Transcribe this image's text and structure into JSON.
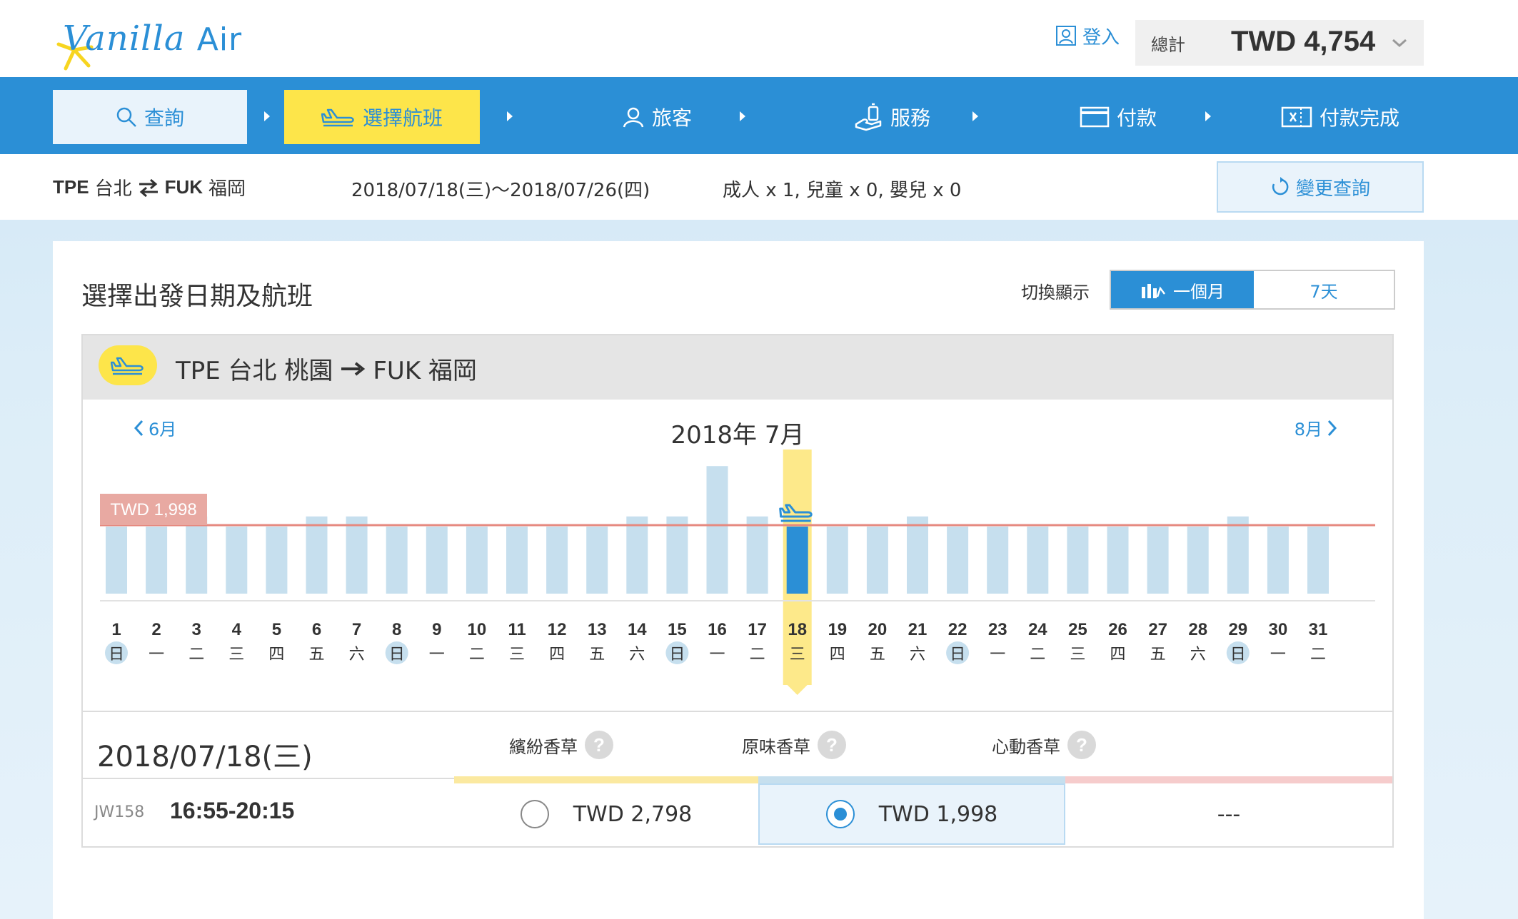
{
  "header": {
    "brand": "Vanilla",
    "brand_suffix": "Air",
    "login_label": "登入",
    "total_label": "總計",
    "total_value": "TWD 4,754"
  },
  "nav": {
    "steps": [
      {
        "label": "查詢"
      },
      {
        "label": "選擇航班"
      },
      {
        "label": "旅客"
      },
      {
        "label": "服務"
      },
      {
        "label": "付款"
      },
      {
        "label": "付款完成"
      }
    ]
  },
  "summary": {
    "origin_code": "TPE",
    "origin_name": "台北",
    "dest_code": "FUK",
    "dest_name": "福岡",
    "dates": "2018/07/18(三)～2018/07/26(四)",
    "passengers": "成人 x 1,  兒童 x 0,  嬰兒 x 0",
    "change_label": "變更查詢"
  },
  "card": {
    "title": "選擇出發日期及航班",
    "toggle_label": "切換顯示",
    "toggle_month": "一個月",
    "toggle_week": "7天",
    "route_title_from": "TPE 台北 桃園",
    "route_title_to": "FUK 福岡",
    "prev_month": "6月",
    "next_month": "8月",
    "month_title": "2018年 7月"
  },
  "chart_data": {
    "type": "bar",
    "title": "2018年 7月",
    "lowest_price_label": "TWD 1,998",
    "selected_day": 18,
    "categories": [
      1,
      2,
      3,
      4,
      5,
      6,
      7,
      8,
      9,
      10,
      11,
      12,
      13,
      14,
      15,
      16,
      17,
      18,
      19,
      20,
      21,
      22,
      23,
      24,
      25,
      26,
      27,
      28,
      29,
      30,
      31
    ],
    "weekdays": [
      "日",
      "一",
      "二",
      "三",
      "四",
      "五",
      "六",
      "日",
      "一",
      "二",
      "三",
      "四",
      "五",
      "六",
      "日",
      "一",
      "二",
      "三",
      "四",
      "五",
      "六",
      "日",
      "一",
      "二",
      "三",
      "四",
      "五",
      "六",
      "日",
      "一",
      "二"
    ],
    "values": [
      1998,
      1998,
      2300,
      1998,
      1998,
      2300,
      2300,
      1998,
      1998,
      1998,
      1998,
      1998,
      1998,
      2300,
      2300,
      3800,
      2300,
      1998,
      1998,
      1998,
      2300,
      1998,
      1998,
      1998,
      1998,
      1998,
      1998,
      1998,
      2300,
      1998,
      1998
    ],
    "colors": {
      "bar": "#c6dfee",
      "selected_bar": "#2b8fd6",
      "line": "#e68a80",
      "sunday": "#c6dfee",
      "highlight": "#fde98a"
    }
  },
  "fares": {
    "selected_date": "2018/07/18(三)",
    "columns": [
      {
        "name": "繽紛香草",
        "color": "#fbe9a0"
      },
      {
        "name": "原味香草",
        "color": "#c6dfee"
      },
      {
        "name": "心動香草",
        "color": "#f6cccc"
      }
    ],
    "flights": [
      {
        "number": "JW158",
        "time": "16:55-20:15",
        "prices": [
          "TWD 2,798",
          "TWD 1,998",
          "---"
        ]
      }
    ]
  }
}
